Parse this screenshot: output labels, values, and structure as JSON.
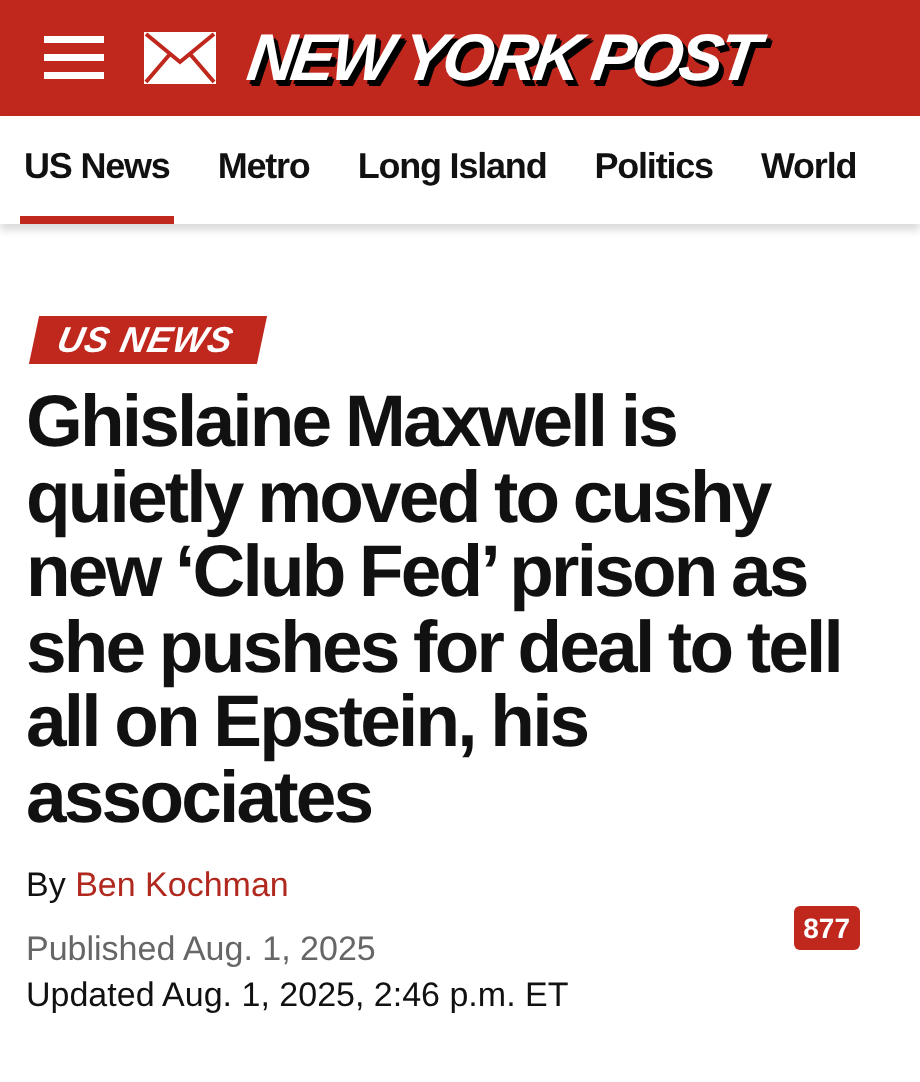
{
  "header": {
    "logo": "NEW YORK POST"
  },
  "nav": [
    {
      "label": "US News",
      "selected": true
    },
    {
      "label": "Metro",
      "selected": false
    },
    {
      "label": "Long Island",
      "selected": false
    },
    {
      "label": "Politics",
      "selected": false
    },
    {
      "label": "World",
      "selected": false
    }
  ],
  "article": {
    "section": "US NEWS",
    "headline": "Ghislaine Maxwell is quietly moved to cushy new ‘Club Fed’ prison as she pushes for deal to tell all on Epstein, his associates",
    "byline_prefix": "By",
    "author": "Ben Kochman",
    "published": "Published Aug. 1, 2025",
    "updated": "Updated Aug. 1, 2025, 2:46 p.m. ET",
    "comments": "877"
  }
}
